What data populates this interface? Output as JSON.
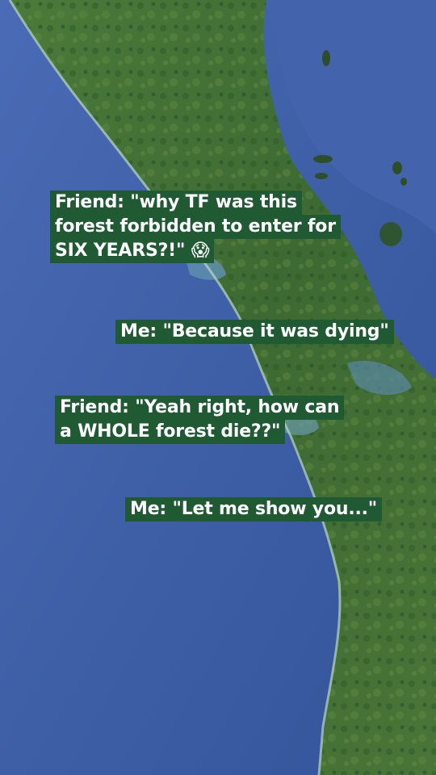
{
  "captions": [
    {
      "lines": [
        "Friend: \"why TF was this",
        "forest forbidden to enter for",
        "SIX YEARS?!\" 😱"
      ]
    },
    {
      "lines": [
        "Me: \"Because it was dying\""
      ]
    },
    {
      "lines": [
        "Friend: \"Yeah right, how can",
        "a WHOLE forest die??\""
      ]
    },
    {
      "lines": [
        "Me: \"Let me show you...\""
      ]
    }
  ],
  "colors": {
    "ocean": "#3e5fa6",
    "land": "#3f6e34",
    "caption_bg": "#1f5a33",
    "caption_text": "#ffffff"
  }
}
